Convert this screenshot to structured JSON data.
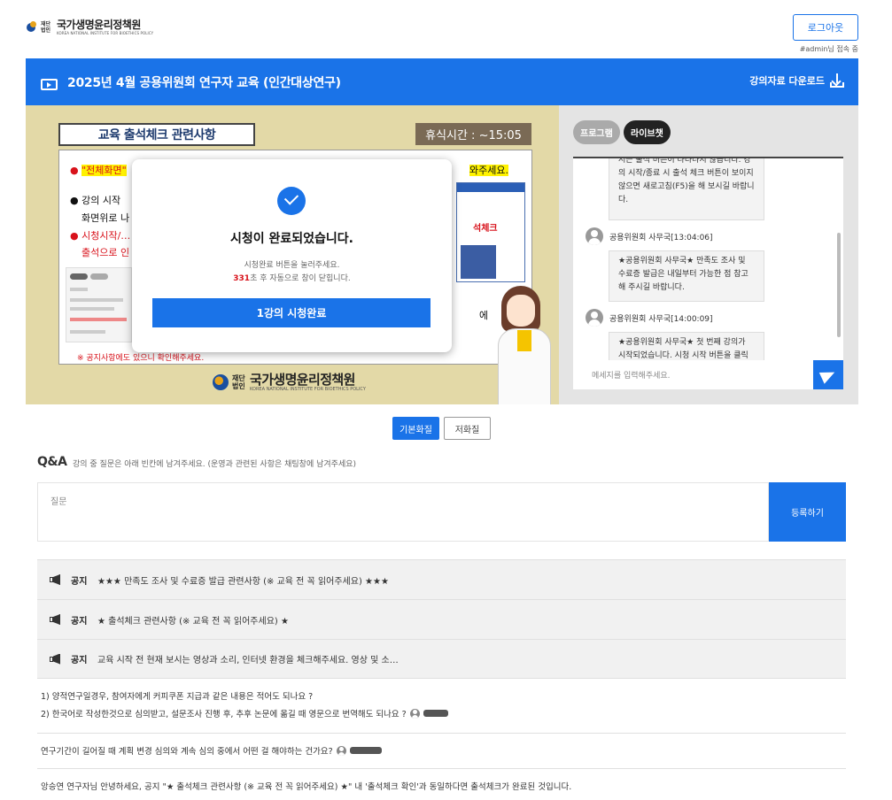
{
  "header": {
    "logo_foundation": "재단법인",
    "logo_name": "국가생명윤리정책원",
    "logo_sub": "KOREA NATIONAL INSTITUTE FOR BIOETHICS POLICY",
    "logout_label": "로그아웃",
    "user_status": "#admin님 접속 중"
  },
  "course": {
    "title": "2025년 4월 공용위원회 연구자 교육 (인간대상연구)",
    "download_label": "강의자료 다운로드",
    "icon": "tv-play-icon"
  },
  "slide": {
    "title": "교육 출석체크 관련사항",
    "break_time": "휴식시간 : ~15:05",
    "line1": "\"전체화면\"",
    "line1_tail": "와주세요.",
    "line2": "강의 시작",
    "line2b": "화면위로 나",
    "line3": "시청시작/…",
    "line3b": "출석으로 인",
    "mini_red": "석체크",
    "right_text": "에",
    "note": "※ 공지사항에도 있으니 확인해주세요.",
    "footer_foundation": "재단법인",
    "footer_name": "국가생명윤리정책원",
    "footer_sub": "KOREA NATIONAL INSTITUTE FOR BIOETHICS POLICY"
  },
  "modal": {
    "title": "시청이 완료되었습니다.",
    "message1": "시청완료 버튼을 눌러주세요.",
    "countdown": "331",
    "message2_tail": "초 후 자동으로 창이 닫힙니다.",
    "button_label": "1강의 시청완료"
  },
  "chat": {
    "tab_program": "프로그램",
    "tab_live": "라이브챗",
    "bubble0": "서는 출석 버튼이 나타나지 않습니다. 강의 시작/종료 시 출석 체크 버튼이 보이지 않으면 새로고침(F5)을 해 보시길 바랍니다.",
    "msg1_sender": "공용위원회 사무국[13:04:06]",
    "msg1_text": "★공용위원회 사무국★ 만족도 조사 및 수료증 발급은 내일부터 가능한 점 참고해 주시길 바랍니다.",
    "msg2_sender": "공용위원회 사무국[14:00:09]",
    "msg2_text": "★공용위원회 사무국★ 첫 번째 강의가 시작되었습니다. 시청 시작 버튼을 클릭해",
    "input_placeholder": "메세지를 입력해주세요."
  },
  "quality": {
    "basic": "기본화질",
    "low": "저화질"
  },
  "qa": {
    "title": "Q&A",
    "desc": "강의 중 질문은 아래 빈칸에 남겨주세요. (운영과 관련된 사항은 채팅창에 남겨주세요)",
    "question_placeholder": "질문",
    "submit_label": "등록하기",
    "notices": [
      {
        "tag": "공지",
        "text": "★★★ 만족도 조사 및 수료증 발급 관련사항 (※ 교육 전 꼭 읽어주세요) ★★★"
      },
      {
        "tag": "공지",
        "text": "★ 출석체크 관련사항 (※ 교육 전 꼭 읽어주세요) ★"
      },
      {
        "tag": "공지",
        "text": "교육 시작 전 현재 보시는 영상과 소리, 인터넷 환경을 체크해주세요. 영상 및 소…"
      }
    ],
    "items": [
      {
        "line1": "1) 양적연구일경우, 참여자에게 커피쿠폰 지급과 같은 내용은 적어도 되나요 ?",
        "line2": "2) 한국어로 작성한것으로 심의받고, 설문조사 진행 후, 추후 논문에 옮길 때 영문으로 번역해도 되나요 ?"
      },
      {
        "line1": "연구기간이 길어질 때 계획 변경 심의와 계속 심의 중에서 어떤 걸 해야하는 건가요?"
      },
      {
        "line1": "앙승연 연구자님 안녕하세요, 공지 \"★ 출석체크 관련사항 (※ 교육 전 꼭 읽어주세요) ★\" 내 '출석체크 확인'과 동일하다면 출석체크가 완료된 것입니다."
      }
    ]
  },
  "colors": {
    "accent": "#1a73e8",
    "video_bg": "#e3d9a7",
    "alert_red": "#d8121b"
  }
}
